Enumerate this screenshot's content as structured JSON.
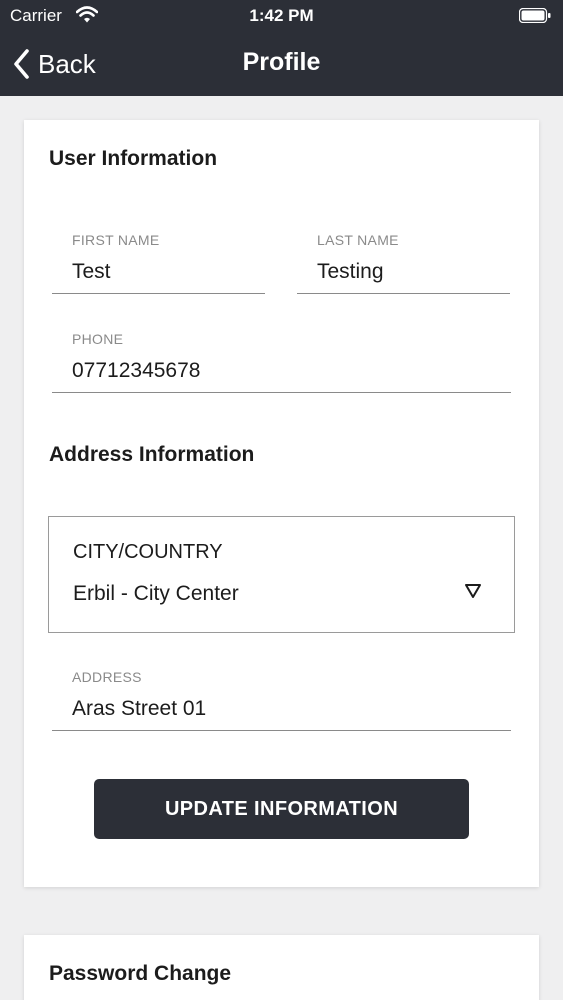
{
  "status_bar": {
    "carrier": "Carrier",
    "time": "1:42 PM"
  },
  "nav": {
    "back_label": "Back",
    "title": "Profile"
  },
  "user_info": {
    "title": "User Information",
    "first_name": {
      "label": "FIRST NAME",
      "value": "Test"
    },
    "last_name": {
      "label": "LAST NAME",
      "value": "Testing"
    },
    "phone": {
      "label": "PHONE",
      "value": "07712345678"
    }
  },
  "address_info": {
    "title": "Address Information",
    "city_country": {
      "label": "CITY/COUNTRY",
      "value": "Erbil - City Center"
    },
    "address": {
      "label": "ADDRESS",
      "value": "Aras Street 01"
    }
  },
  "update_button": "UPDATE INFORMATION",
  "password": {
    "title": "Password Change"
  }
}
